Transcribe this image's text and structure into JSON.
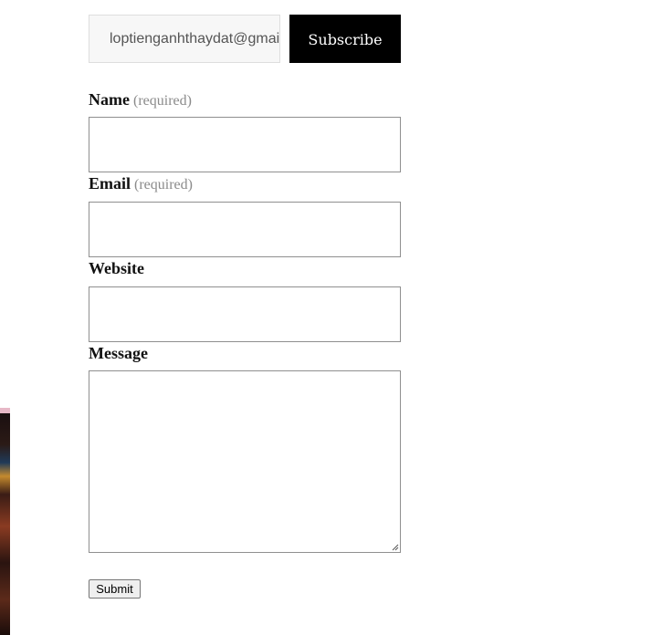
{
  "subscribe": {
    "email_value": "loptienganhthaydat@gmail.com",
    "button_label": "Subscribe"
  },
  "contact_form": {
    "name_label": "Name",
    "email_label": "Email",
    "website_label": "Website",
    "message_label": "Message",
    "required_text": "(required)",
    "submit_label": "Submit"
  }
}
